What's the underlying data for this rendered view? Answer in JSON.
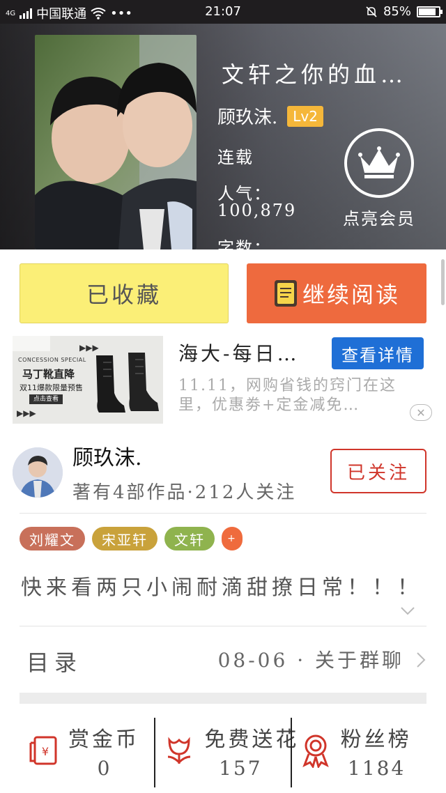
{
  "status_bar": {
    "network": "4G",
    "carrier": "中国联通",
    "more": "•••",
    "time": "21:07",
    "battery": "85%",
    "battery_level": 0.85,
    "icons": [
      "signal-icon",
      "wifi-icon",
      "bell-muted-icon",
      "battery-icon"
    ]
  },
  "book": {
    "title": "文轩之你的血…",
    "author": "顾玖沫.",
    "level": "Lv2",
    "status": "连载",
    "popularity_label": "人气：",
    "popularity_value": "100,879",
    "word_count_label": "字数：",
    "vip_label": "点亮会员"
  },
  "actions": {
    "favorited_label": "已收藏",
    "continue_label": "继续阅读"
  },
  "ad": {
    "title": "海大-每日…",
    "button": "查看详情",
    "description": "11.11，网购省钱的窍门在这里，优惠劵+定金减免…",
    "image_tag": "CONCESSION SPECIAL",
    "image_headline": "马丁靴直降",
    "image_sub": "双11爆款限量预售",
    "image_cta": "点击查看"
  },
  "author_card": {
    "name": "顾玖沫.",
    "stats": "著有4部作品·212人关注",
    "follow_label": "已关注"
  },
  "tags": [
    {
      "label": "刘耀文",
      "color": "#c8705a"
    },
    {
      "label": "宋亚轩",
      "color": "#c9a23b"
    },
    {
      "label": "文轩",
      "color": "#8fb34e"
    },
    {
      "label": "+",
      "color": "#ef6b3d"
    }
  ],
  "intro": "快来看两只小闹耐滴甜撩日常！！！",
  "toc": {
    "label": "目录",
    "latest": "08-06 · 关于群聊"
  },
  "bottom_stats": [
    {
      "icon": "red-envelope-icon",
      "label": "赏金币",
      "value": "0"
    },
    {
      "icon": "flower-icon",
      "label": "免费送花",
      "value": "157"
    },
    {
      "icon": "ribbon-medal-icon",
      "label": "粉丝榜",
      "value": "1184"
    }
  ],
  "colors": {
    "accent_orange": "#ee6a3e",
    "fav_yellow": "#fbef77",
    "follow_red": "#d0352a",
    "ad_blue": "#1f6fd6"
  }
}
